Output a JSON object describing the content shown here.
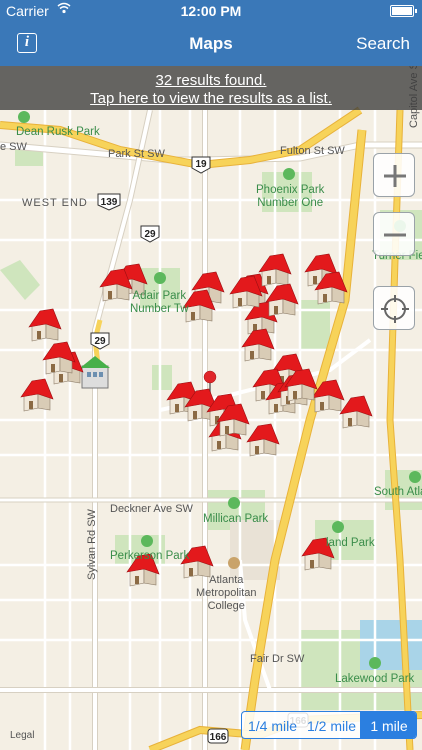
{
  "status_bar": {
    "carrier": "Carrier",
    "time": "12:00 PM"
  },
  "nav_bar": {
    "title": "Maps",
    "info_glyph": "i",
    "search_label": "Search"
  },
  "banner": {
    "results": "32 results found.",
    "list_prompt": "Tap here to view the results as a list."
  },
  "map_labels": {
    "dean_rusk_park": "Dean Rusk Park",
    "park_st": "Park St SW",
    "fulton_st": "Fulton St SW",
    "west_end": "WEST END",
    "phoenix_park": "Phoenix Park\nNumber One",
    "capitol_ave": "Capitol Ave S",
    "turner_field": "Turner Fie",
    "adair_park": "Adair Park\nNumber Tw",
    "deckner_ave": "Deckner Ave SW",
    "millican_park": "Millican Park",
    "south_atl": "South Atla",
    "perkerson_park": "Perkerson Park",
    "atlanta_college": "Atlanta\nMetropolitan\nCollege",
    "lakewood_park": "Lakewood Park",
    "fair_dr": "Fair Dr SW",
    "sylvan_rd": "Sylvan Rd SW",
    "leland_park": "land Park",
    "left_edge_se": "e SW"
  },
  "shields": {
    "r19": "19",
    "r139": "139",
    "r29a": "29",
    "r29b": "29",
    "i166a": "166",
    "i166b": "166"
  },
  "map_controls": {
    "zoom_in": "+",
    "zoom_out": "−"
  },
  "scale": {
    "quarter": "1/4 mile",
    "half": "1/2 mile",
    "one": "1 mile",
    "selected": "1 mile"
  },
  "legal": "Legal",
  "result_count": 32
}
